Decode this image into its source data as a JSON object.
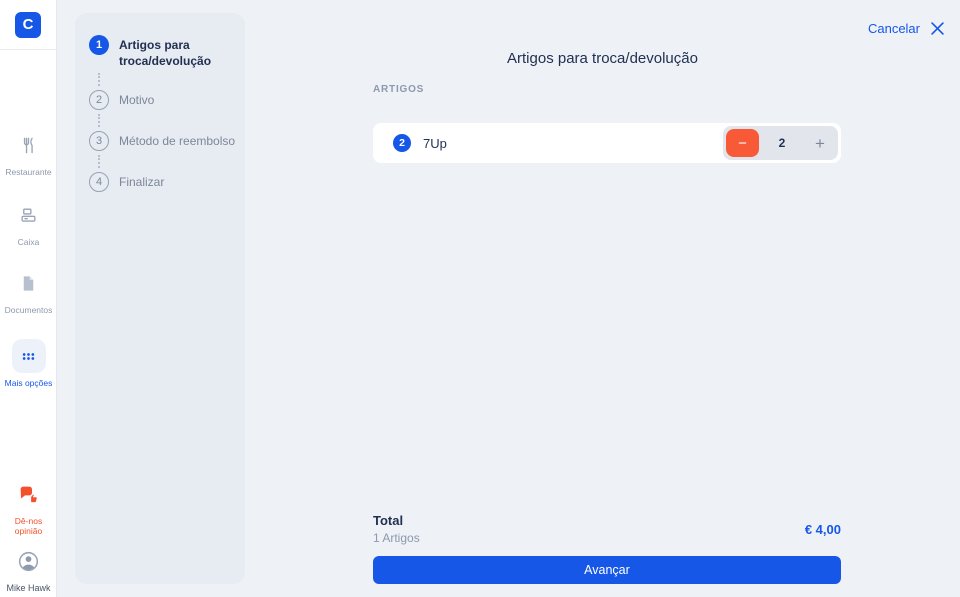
{
  "app": {
    "logo_letter": "C"
  },
  "colors": {
    "primary_blue": "#1657e8",
    "accent_orange": "#f85a38",
    "feedback_red": "#f4502c",
    "panel_bg": "#e7ebf2",
    "page_bg": "#eef1f6"
  },
  "sidebar": {
    "items": [
      {
        "label": "Restaurante"
      },
      {
        "label": "Caixa"
      },
      {
        "label": "Documentos"
      },
      {
        "label": "Mais opções",
        "active": true
      }
    ],
    "footer_items": [
      {
        "label": "Dê-nos opinião"
      },
      {
        "label": "Mike Hawk"
      }
    ]
  },
  "stepper": {
    "steps": [
      {
        "number": "1",
        "label": "Artigos para troca/devolução",
        "active": true
      },
      {
        "number": "2",
        "label": "Motivo",
        "active": false
      },
      {
        "number": "3",
        "label": "Método de reembolso",
        "active": false
      },
      {
        "number": "4",
        "label": "Finalizar",
        "active": false
      }
    ]
  },
  "header": {
    "cancel_label": "Cancelar"
  },
  "main": {
    "title": "Artigos para troca/devolução",
    "section_label": "ARTIGOS",
    "items": [
      {
        "badge_count": "2",
        "name": "7Up",
        "quantity": "2",
        "minus_glyph": "−",
        "plus_glyph": "+"
      }
    ],
    "footer": {
      "total_label": "Total",
      "items_count": "1 Artigos",
      "total_amount": "€ 4,00",
      "advance_label": "Avançar"
    }
  }
}
